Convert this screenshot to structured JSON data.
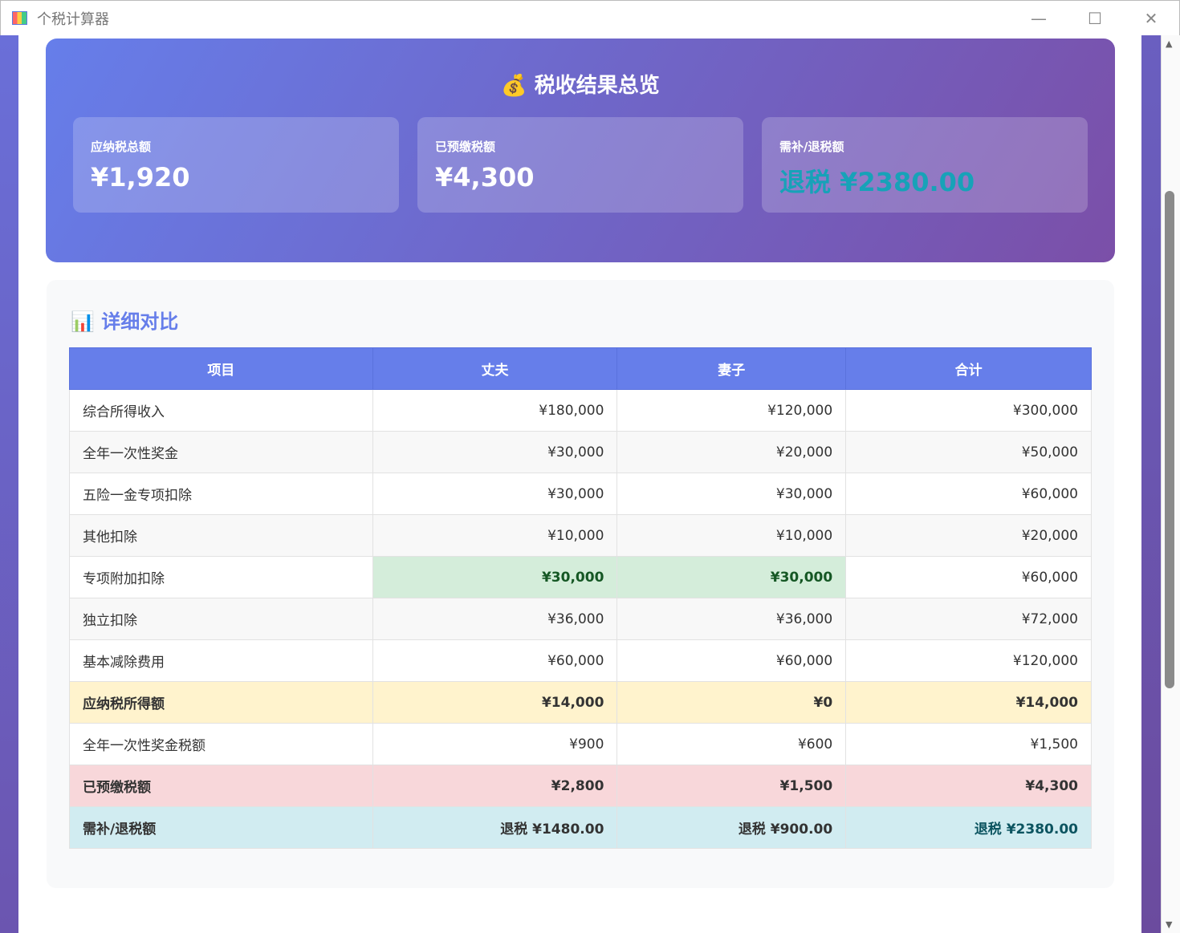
{
  "window": {
    "title": "个税计算器",
    "minimize": "—",
    "maximize": "☐",
    "close": "✕"
  },
  "summary": {
    "icon": "💰",
    "title": "税收结果总览",
    "cards": [
      {
        "label": "应纳税总额",
        "value": "¥1,920"
      },
      {
        "label": "已预缴税额",
        "value": "¥4,300"
      },
      {
        "label": "需补/退税额",
        "value": "退税 ¥2380.00",
        "color": "#17a2b8"
      }
    ]
  },
  "detail": {
    "icon": "📊",
    "title": "详细对比",
    "headers": [
      "项目",
      "丈夫",
      "妻子",
      "合计"
    ],
    "rows": [
      [
        "综合所得收入",
        "¥180,000",
        "¥120,000",
        "¥300,000"
      ],
      [
        "全年一次性奖金",
        "¥30,000",
        "¥20,000",
        "¥50,000"
      ],
      [
        "五险一金专项扣除",
        "¥30,000",
        "¥30,000",
        "¥60,000"
      ],
      [
        "其他扣除",
        "¥10,000",
        "¥10,000",
        "¥20,000"
      ],
      [
        "专项附加扣除",
        "¥30,000",
        "¥30,000",
        "¥60,000"
      ],
      [
        "独立扣除",
        "¥36,000",
        "¥36,000",
        "¥72,000"
      ],
      [
        "基本减除费用",
        "¥60,000",
        "¥60,000",
        "¥120,000"
      ],
      [
        "应纳税所得额",
        "¥14,000",
        "¥0",
        "¥14,000"
      ],
      [
        "全年一次性奖金税额",
        "¥900",
        "¥600",
        "¥1,500"
      ],
      [
        "已预缴税额",
        "¥2,800",
        "¥1,500",
        "¥4,300"
      ],
      [
        "需补/退税额",
        "退税 ¥1480.00",
        "退税 ¥900.00",
        "退税 ¥2380.00"
      ]
    ]
  }
}
